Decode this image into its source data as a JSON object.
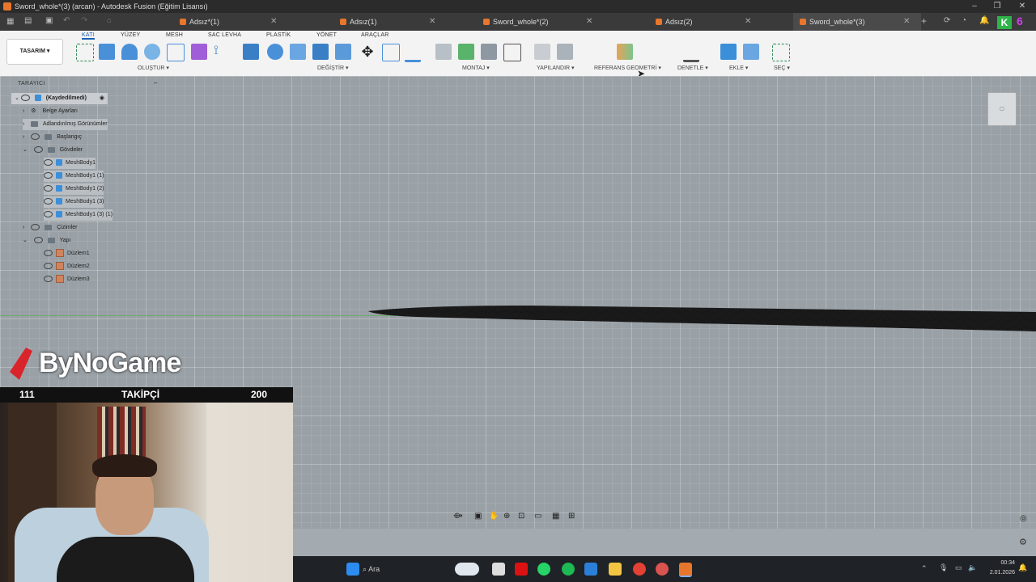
{
  "window": {
    "title": "Sword_whole*(3) (arcan) - Autodesk Fusion (Eğitim Lisansı)"
  },
  "tabs": [
    {
      "label": "Adsız*(1)"
    },
    {
      "label": "Adsız(1)"
    },
    {
      "label": "Sword_whole*(2)"
    },
    {
      "label": "Adsız(2)"
    },
    {
      "label": "Sword_whole*(3)"
    }
  ],
  "ribbon": {
    "workspace": "TASARIM",
    "tabs": [
      "KATI",
      "YÜZEY",
      "MESH",
      "SAC LEVHA",
      "PLASTİK",
      "YÖNET",
      "ARAÇLAR"
    ],
    "groups": [
      "OLUŞTUR",
      "DEĞİŞTİR",
      "MONTAJ",
      "YAPILANDIR",
      "REFERANS GEOMETRİ",
      "DENETLE",
      "EKLE",
      "SEÇ"
    ]
  },
  "browser": {
    "header": "TARAYICI",
    "root": "(Kaydedilmedi)",
    "items": [
      {
        "label": "Belge Ayarları"
      },
      {
        "label": "Adlandırılmış Görünümler"
      },
      {
        "label": "Başlangıç"
      },
      {
        "label": "Gövdeler"
      },
      {
        "label": "MeshBody1"
      },
      {
        "label": "MeshBody1 (1)"
      },
      {
        "label": "MeshBody1 (2)"
      },
      {
        "label": "MeshBody1 (3)"
      },
      {
        "label": "MeshBody1 (3) (1)"
      },
      {
        "label": "Çizimler"
      },
      {
        "label": "Yapı"
      },
      {
        "label": "Düzlem1"
      },
      {
        "label": "Düzlem2"
      },
      {
        "label": "Düzlem3"
      }
    ]
  },
  "overlay": {
    "brand": "ByNoGame",
    "follower_current": "111",
    "follower_label": "TAKİPÇİ",
    "follower_goal": "200"
  },
  "taskbar": {
    "search_label": "Ara",
    "time": "00:34",
    "date": "2.01.2026"
  },
  "colors": {
    "accent": "#1a5fb4",
    "fusion_orange": "#e8762b",
    "canvas": "#9aa1a6"
  }
}
